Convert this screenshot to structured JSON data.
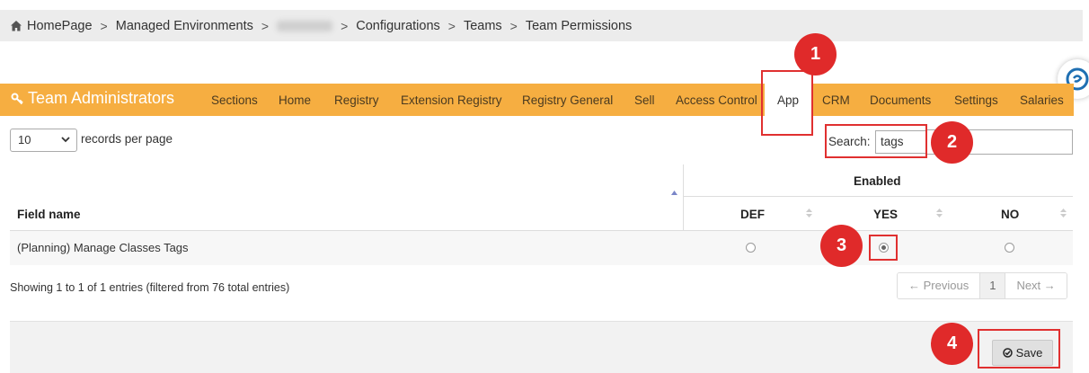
{
  "breadcrumb": {
    "items": [
      "HomePage",
      "Managed Environments",
      "Configurations",
      "Teams",
      "Team Permissions"
    ],
    "separator": ">"
  },
  "header": {
    "title": "Team Administrators",
    "tabs": [
      "Sections",
      "Home",
      "Registry",
      "Extension Registry",
      "Registry General",
      "Sell",
      "Access Control",
      "App",
      "CRM",
      "Documents",
      "Settings",
      "Salaries"
    ],
    "active_tab": "App",
    "bar_color": "#f6ae41"
  },
  "controls": {
    "page_size": "10",
    "records_label": "records per page",
    "search_label": "Search:",
    "search_value": "tags"
  },
  "table": {
    "group_header": "Enabled",
    "columns": [
      "Field name",
      "DEF",
      "YES",
      "NO"
    ],
    "rows": [
      {
        "field": "(Planning) Manage Classes Tags",
        "selected": "YES"
      }
    ]
  },
  "footer_info": "Showing 1 to 1 of 1 entries (filtered from 76 total entries)",
  "pagination": {
    "previous": "← Previous",
    "page": "1",
    "next": "Next →"
  },
  "save_label": "Save",
  "annotations": [
    "1",
    "2",
    "3",
    "4"
  ],
  "colors": {
    "annotation_red": "#e02a2a",
    "header_orange": "#f6ae41"
  }
}
